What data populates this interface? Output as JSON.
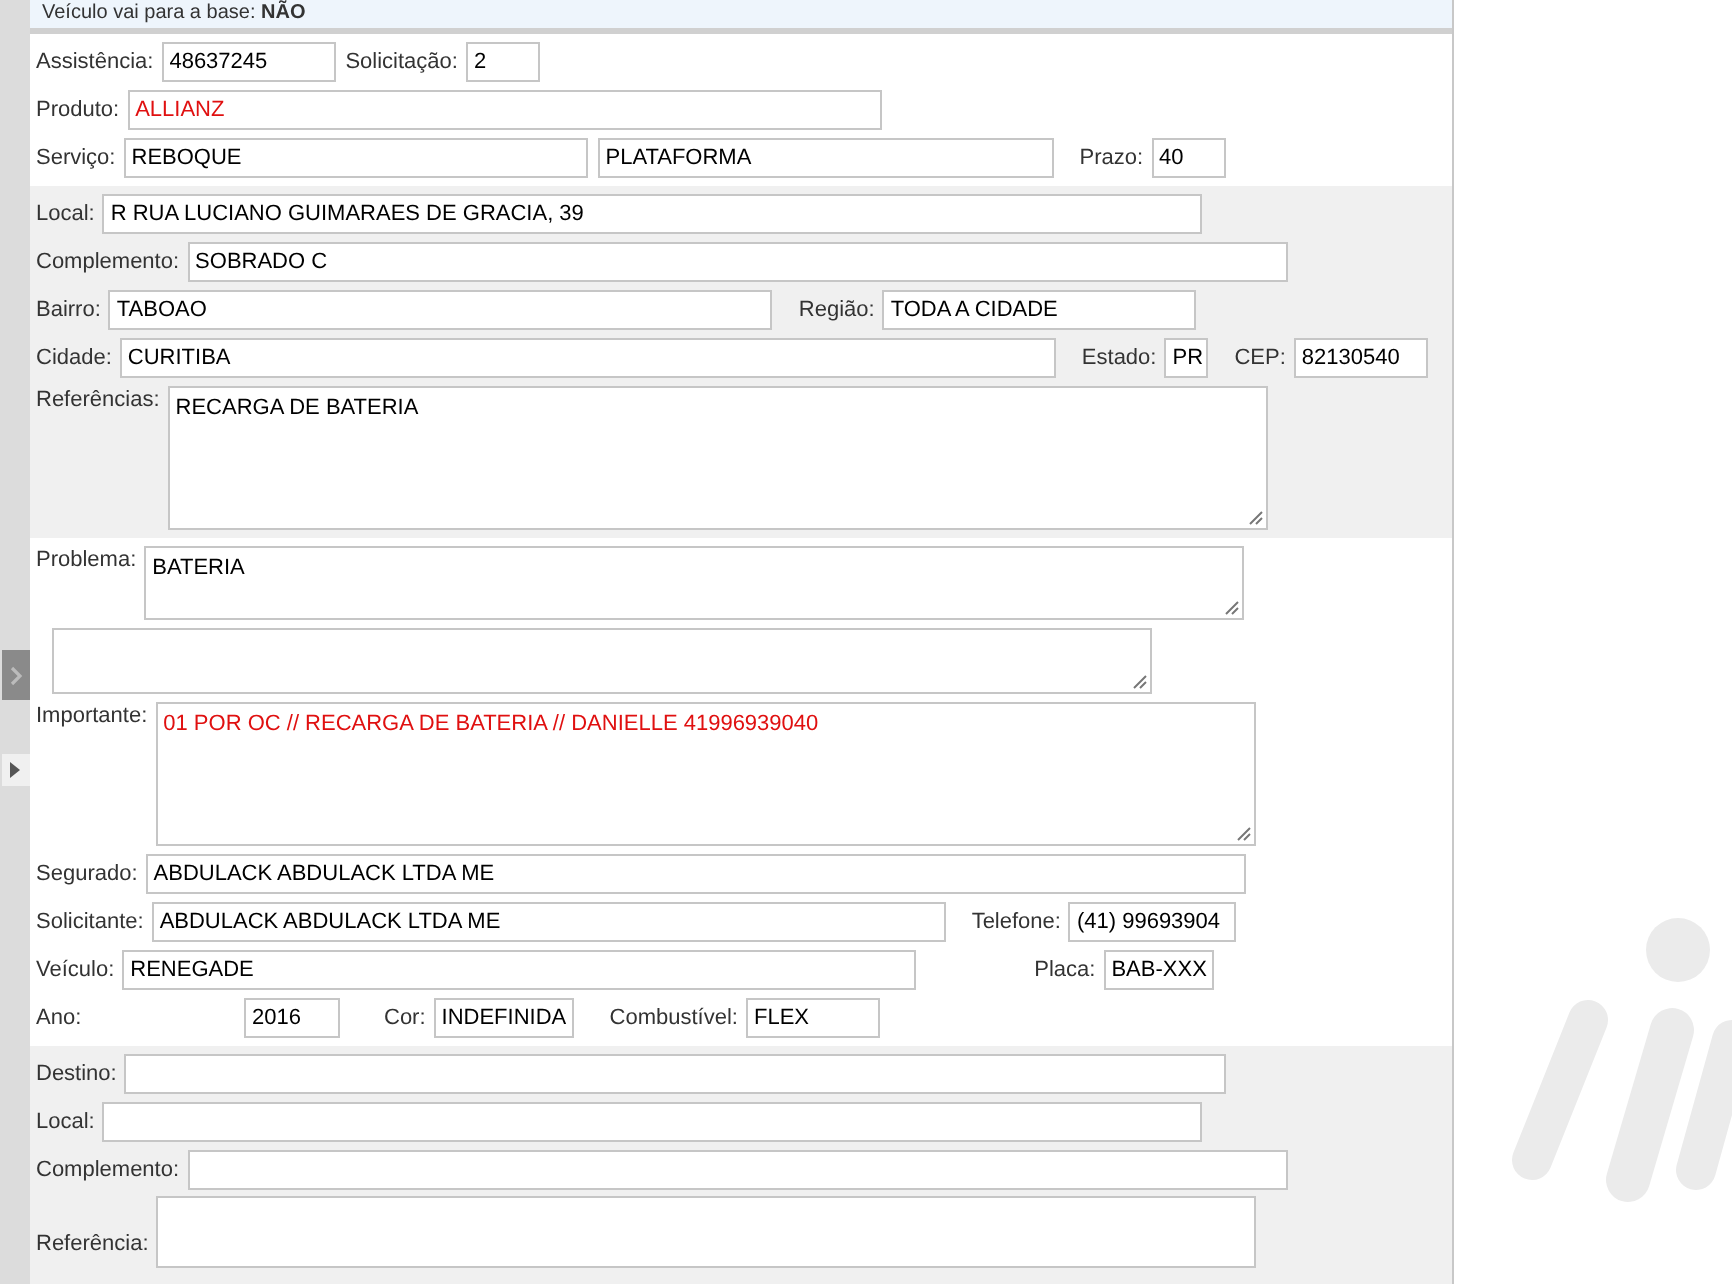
{
  "banner": {
    "label": "Veículo vai para a base:",
    "value": "NÃO"
  },
  "assistencia": {
    "label": "Assistência:",
    "value": "48637245"
  },
  "solicitacao": {
    "label": "Solicitação:",
    "value": "2"
  },
  "produto": {
    "label": "Produto:",
    "value": "ALLIANZ",
    "alert": true
  },
  "servico": {
    "label": "Serviço:",
    "value": "REBOQUE",
    "value_2": "PLATAFORMA"
  },
  "prazo": {
    "label": "Prazo:",
    "value": "40"
  },
  "local": {
    "label": "Local:",
    "value": "R RUA LUCIANO GUIMARAES DE GRACIA, 39"
  },
  "complemento": {
    "label": "Complemento:",
    "value": "SOBRADO C"
  },
  "bairro": {
    "label": "Bairro:",
    "value": "TABOAO"
  },
  "regiao": {
    "label": "Região:",
    "value": "TODA A CIDADE"
  },
  "cidade": {
    "label": "Cidade:",
    "value": "CURITIBA"
  },
  "estado": {
    "label": "Estado:",
    "value": "PR"
  },
  "cep": {
    "label": "CEP:",
    "value": "82130540"
  },
  "referencias": {
    "label": "Referências:",
    "value": "RECARGA DE BATERIA"
  },
  "problema": {
    "label": "Problema:",
    "value": "BATERIA"
  },
  "importante": {
    "label": "Importante:",
    "value": "01 POR OC // RECARGA DE BATERIA // DANIELLE 41996939040",
    "alert": true
  },
  "segurado": {
    "label": "Segurado:",
    "value": "ABDULACK ABDULACK LTDA ME"
  },
  "solicitante": {
    "label": "Solicitante:",
    "value": "ABDULACK ABDULACK LTDA ME"
  },
  "telefone": {
    "label": "Telefone:",
    "value": "(41) 99693904"
  },
  "veiculo": {
    "label": "Veículo:",
    "value": "RENEGADE"
  },
  "placa": {
    "label": "Placa:",
    "value": "BAB-XXX"
  },
  "ano": {
    "label": "Ano:",
    "value": "2016"
  },
  "cor": {
    "label": "Cor:",
    "value": "INDEFINIDA"
  },
  "combustivel": {
    "label": "Combustível:",
    "value": "FLEX"
  },
  "destino": {
    "label": "Destino:"
  },
  "destino_local": {
    "label": "Local:"
  },
  "destino_complemento": {
    "label": "Complemento:"
  },
  "destino_referencia": {
    "label": "Referência:"
  }
}
